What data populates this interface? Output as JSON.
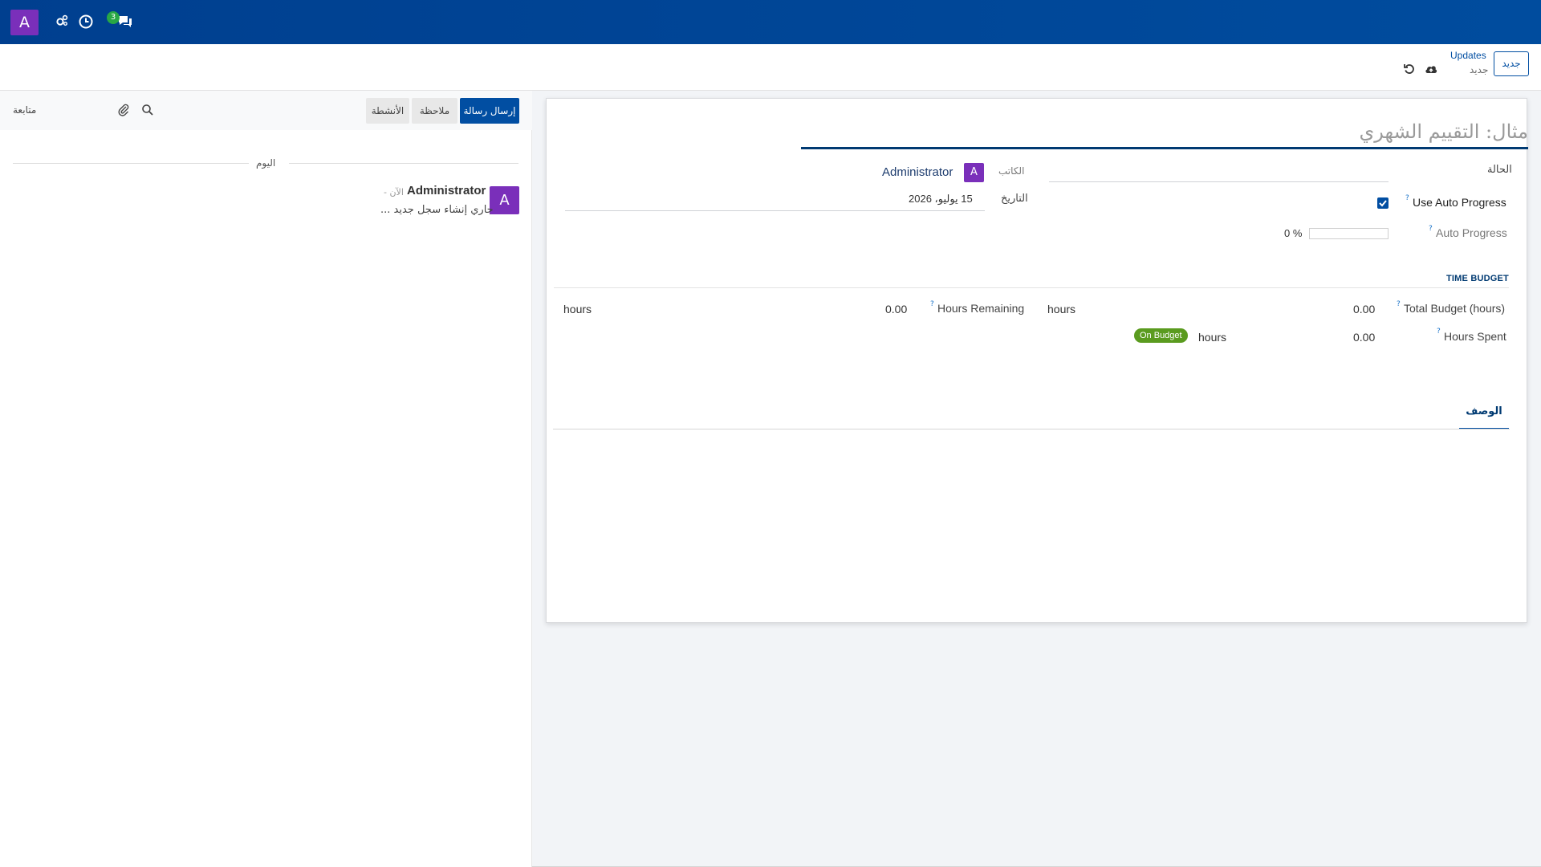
{
  "navbar": {
    "user_initial": "A",
    "messages_count": "3",
    "icons": [
      "settings-icon",
      "clock-icon",
      "messages-icon"
    ]
  },
  "control_bar": {
    "new_button": "جديد",
    "breadcrumb_title": "Updates",
    "breadcrumb_current": "جديد"
  },
  "form": {
    "name_placeholder": "مثال: التقييم الشهري",
    "status_label": "الحالة",
    "author_label": "الكاتب",
    "author_initial": "A",
    "author_name": "Administrator",
    "date_label": "التاريخ",
    "date_value": "15 يوليو، 2026",
    "use_auto_progress_label": "Use Auto Progress",
    "use_auto_progress_checked": true,
    "auto_progress_label": "Auto Progress",
    "auto_progress_value": "0 %",
    "auto_progress_fraction": 0,
    "qmark": "?"
  },
  "time_budget": {
    "section_title": "TIME BUDGET",
    "total_budget_label": "Total Budget (hours)",
    "total_budget_value": "0.00",
    "total_budget_unit": "hours",
    "hours_remaining_label": "Hours Remaining",
    "hours_remaining_value": "0.00",
    "hours_remaining_unit": "hours",
    "hours_spent_label": "Hours Spent",
    "hours_spent_value": "0.00",
    "hours_spent_unit": "hours",
    "budget_badge": "On Budget"
  },
  "tabs": {
    "description": "الوصف"
  },
  "chatter": {
    "send_message": "إرسال رسالة",
    "log_note": "ملاحظة",
    "activities": "الأنشطة",
    "follow": "متابعة",
    "today": "اليوم",
    "message": {
      "avatar_initial": "A",
      "author": "Administrator",
      "time": "- الآن",
      "body": "جاري إنشاء سجل جديد ..."
    }
  },
  "colors": {
    "navbar": "#004c9e",
    "primary": "#014ea2",
    "avatar": "#7a2fba",
    "on_budget": "#5a9b1f",
    "badge_green": "#28a745"
  }
}
